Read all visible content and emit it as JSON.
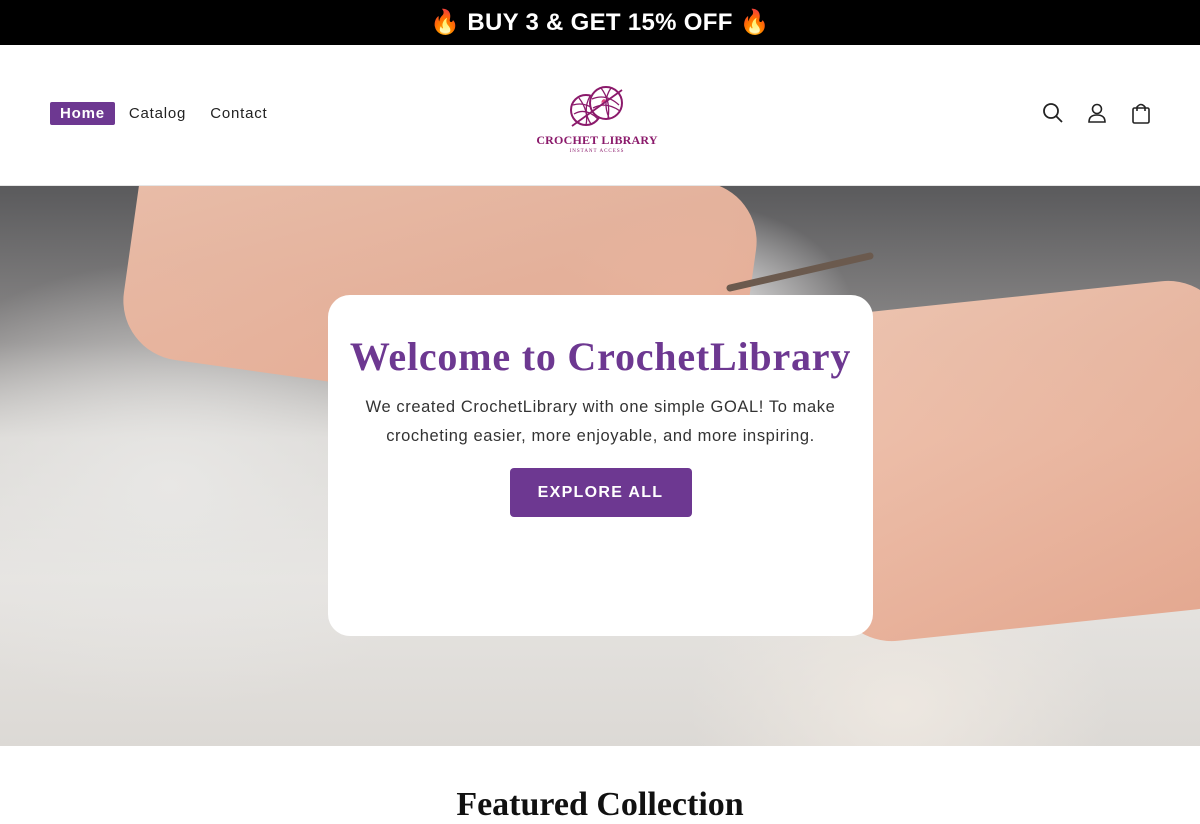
{
  "announcement": {
    "text": "🔥 BUY 3 & GET 15% OFF 🔥"
  },
  "nav": {
    "items": [
      {
        "label": "Home"
      },
      {
        "label": "Catalog"
      },
      {
        "label": "Contact"
      }
    ]
  },
  "logo": {
    "text": "CROCHET LIBRARY",
    "subtext": "INSTANT ACCESS"
  },
  "header_icons": [
    "search-icon",
    "account-icon",
    "cart-icon"
  ],
  "hero": {
    "title": "Welcome to CrochetLibrary",
    "text": "We created CrochetLibrary with one simple GOAL! To make crocheting easier, more enjoyable, and more inspiring.",
    "button_label": "EXPLORE ALL"
  },
  "featured": {
    "title": "Featured Collection"
  },
  "colors": {
    "accent": "#6d3891",
    "logo": "#8b1a6b",
    "announcement_bg": "#000000"
  }
}
